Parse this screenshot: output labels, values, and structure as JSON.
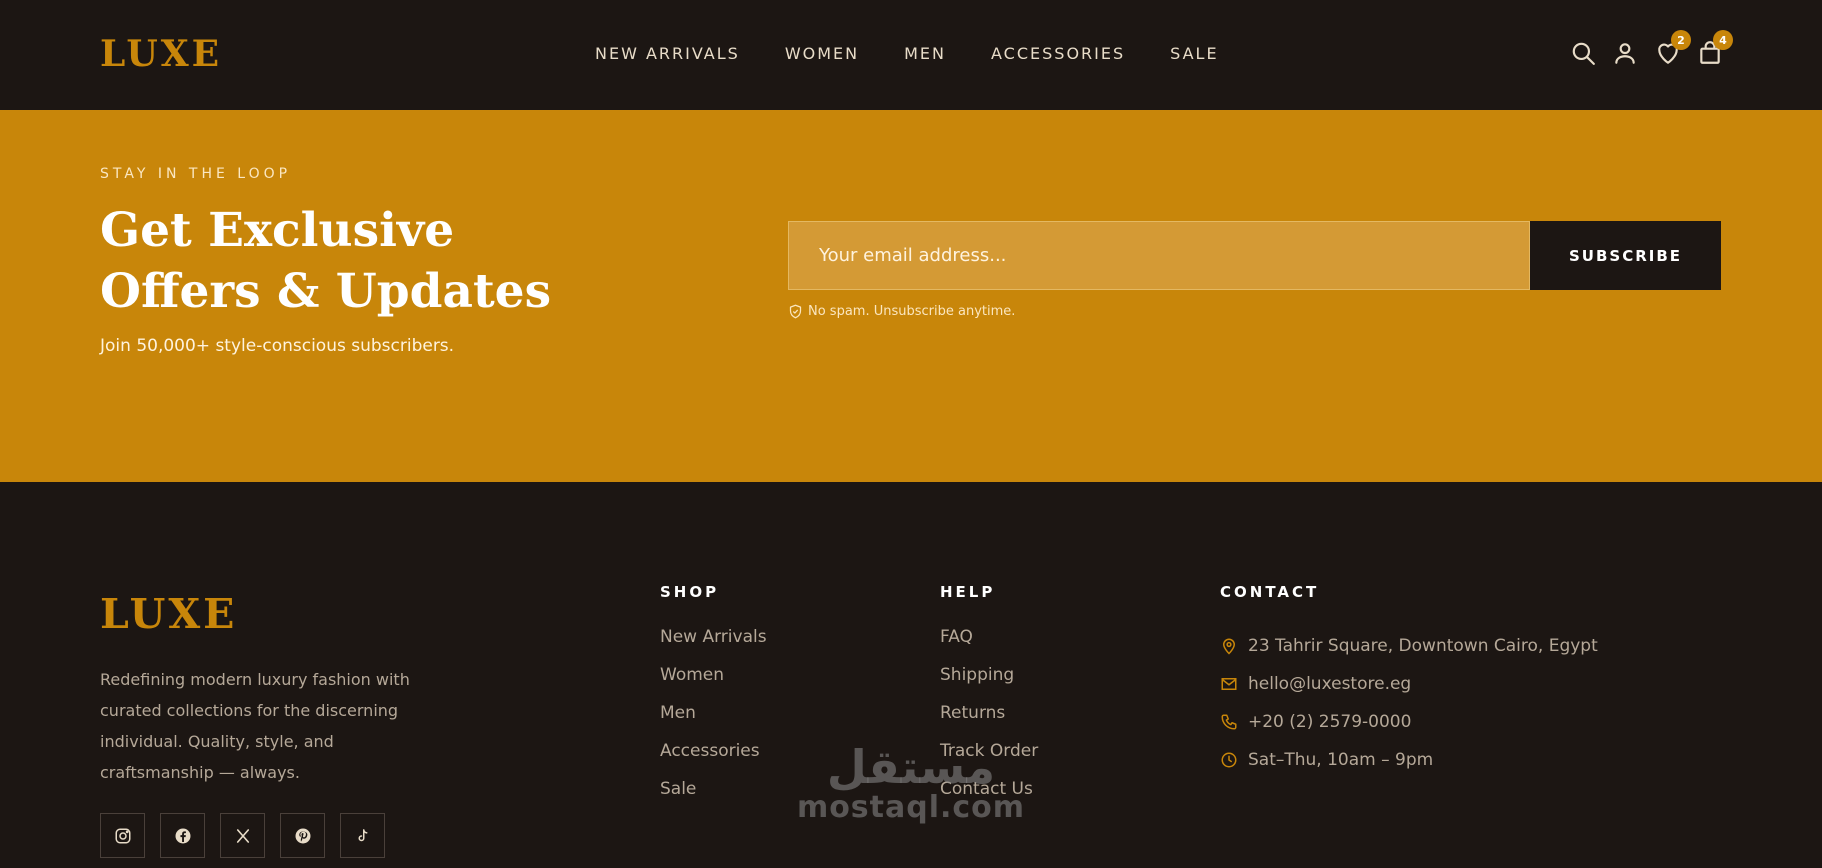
{
  "header": {
    "logo": "LUXE",
    "nav": [
      "NEW ARRIVALS",
      "WOMEN",
      "MEN",
      "ACCESSORIES",
      "SALE"
    ],
    "wishlist_count": "2",
    "cart_count": "4"
  },
  "newsletter": {
    "eyebrow": "STAY IN THE LOOP",
    "headline_line1": "Get Exclusive",
    "headline_line2": "Offers & Updates",
    "subline": "Join 50,000+ style-conscious subscribers.",
    "email_placeholder": "Your email address...",
    "subscribe_label": "SUBSCRIBE",
    "note": "No spam. Unsubscribe anytime."
  },
  "footer": {
    "logo": "LUXE",
    "description": "Redefining modern luxury fashion with curated collections for the discerning individual. Quality, style, and craftsmanship — always.",
    "socials": [
      "instagram-icon",
      "facebook-icon",
      "x-icon",
      "pinterest-icon",
      "tiktok-icon"
    ],
    "shop": {
      "title": "SHOP",
      "links": [
        "New Arrivals",
        "Women",
        "Men",
        "Accessories",
        "Sale"
      ]
    },
    "help": {
      "title": "HELP",
      "links": [
        "FAQ",
        "Shipping",
        "Returns",
        "Track Order",
        "Contact Us"
      ]
    },
    "contact": {
      "title": "CONTACT",
      "address": "23 Tahrir Square, Downtown Cairo, Egypt",
      "email": "hello@luxestore.eg",
      "phone": "+20 (2) 2579-0000",
      "hours": "Sat–Thu, 10am – 9pm"
    }
  },
  "watermark": {
    "arabic": "مستقل",
    "latin": "mostaql.com"
  },
  "colors": {
    "accent": "#c8860a",
    "dark": "#1c1613",
    "muted_text": "#b5a898"
  }
}
